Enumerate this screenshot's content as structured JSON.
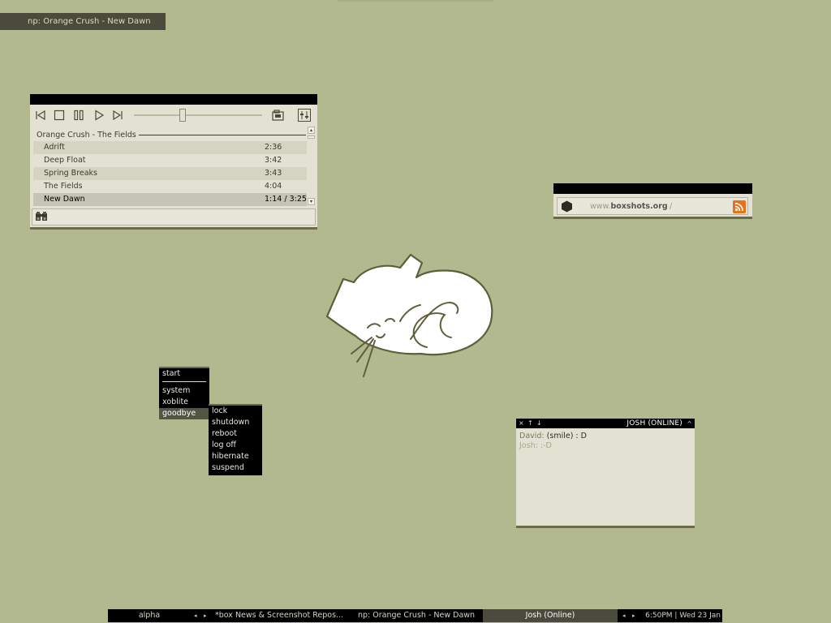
{
  "now_playing_bar": {
    "text": "np: Orange Crush - New Dawn"
  },
  "player": {
    "playlist_header": "Orange Crush - The Fields",
    "tracks": [
      {
        "title": "Adrift",
        "duration": "2:36"
      },
      {
        "title": "Deep Float",
        "duration": "3:42"
      },
      {
        "title": "Spring Breaks",
        "duration": "3:43"
      },
      {
        "title": "The Fields",
        "duration": "4:04"
      },
      {
        "title": "New Dawn",
        "duration": "1:14 / 3:25"
      }
    ],
    "current_track_index": 4,
    "seek_position": 0.37
  },
  "boxshots": {
    "url_prefix": "www.",
    "url_domain": "boxshots.org",
    "url_slash": "/"
  },
  "start_menu": {
    "title": "start",
    "items": [
      "system",
      "xoblite",
      "goodbye"
    ],
    "active_item": "goodbye",
    "submenu": [
      "lock",
      "shutdown",
      "reboot",
      "log off",
      "hibernate",
      "suspend"
    ]
  },
  "chat": {
    "title": "JOSH (ONLINE)",
    "buttons": [
      "×",
      "↑",
      "↓"
    ],
    "collapse": "^",
    "messages": [
      {
        "sender": "David:",
        "text": "(smile) : D"
      },
      {
        "sender": "Josh:",
        "text": ":-D"
      }
    ]
  },
  "taskbar": {
    "workspace": "alpha",
    "prev_arrow": "◂",
    "next_arrow": "▸",
    "tasks": [
      "*box News & Screenshot Repos...",
      "np: Orange Crush - New Dawn",
      "Josh (Online)"
    ],
    "active_task": "Josh (Online)",
    "clock": "6:50PM | Wed 23 Jan"
  },
  "colors": {
    "desktop": "#b3b98e",
    "window_bg": "#e3e2d2",
    "accent_dark": "#4a4b3a",
    "rss_orange": "#e8711a"
  }
}
